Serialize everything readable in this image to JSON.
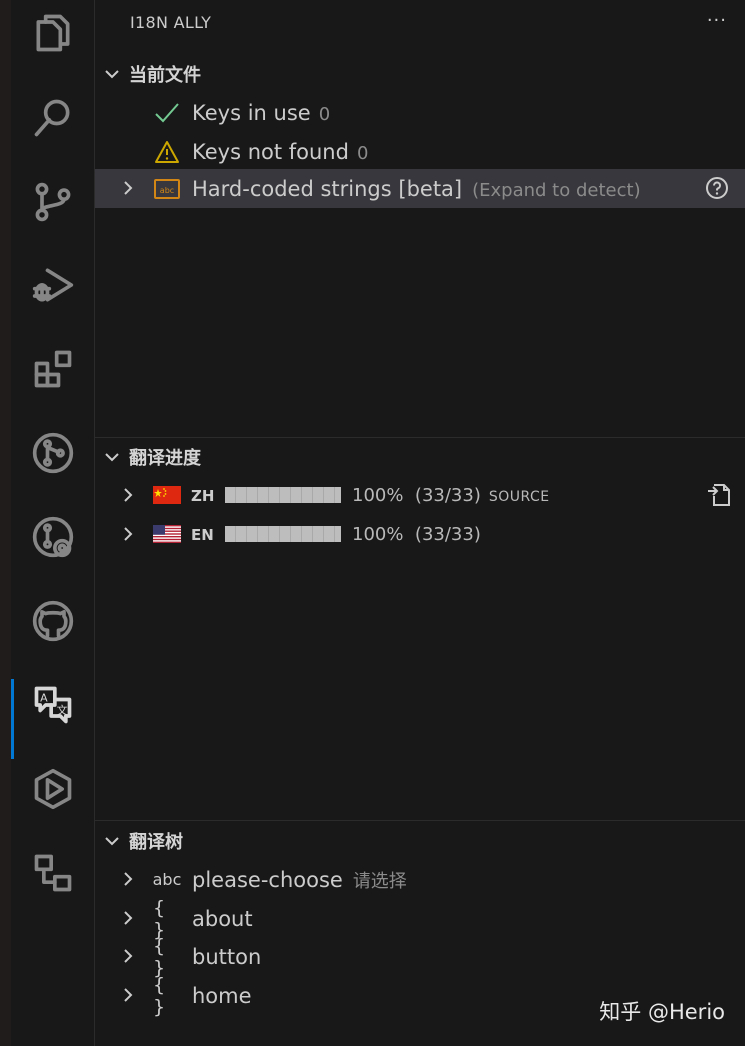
{
  "view_title": "I18N ALLY",
  "more_actions": "···",
  "current_file": {
    "header": "当前文件",
    "items": [
      {
        "icon": "check-icon",
        "label": "Keys in use",
        "count": "0"
      },
      {
        "icon": "warning-icon",
        "label": "Keys not found",
        "count": "0"
      },
      {
        "icon": "abc-icon",
        "label": "Hard-coded strings [beta]",
        "description": "(Expand to detect)"
      }
    ]
  },
  "progress": {
    "header": "翻译进度",
    "locales": [
      {
        "code": "ZH",
        "flag": "cn-flag",
        "progress": 1.0,
        "percent": "100%",
        "fraction": "(33/33)",
        "badge": "SOURCE"
      },
      {
        "code": "EN",
        "flag": "us-flag",
        "progress": 1.0,
        "percent": "100%",
        "fraction": "(33/33)"
      }
    ]
  },
  "tree": {
    "header": "翻译树",
    "items": [
      {
        "icon": "abc",
        "label": "please-choose",
        "value": "请选择"
      },
      {
        "icon": "{ }",
        "label": "about"
      },
      {
        "icon": "{ }",
        "label": "button"
      },
      {
        "icon": "{ }",
        "label": "home"
      }
    ]
  },
  "watermark": "知乎 @Herio",
  "colors": {
    "accent": "#0078d4",
    "check": "#73c991",
    "warning": "#cca700",
    "cn_flag": "#de2910"
  }
}
